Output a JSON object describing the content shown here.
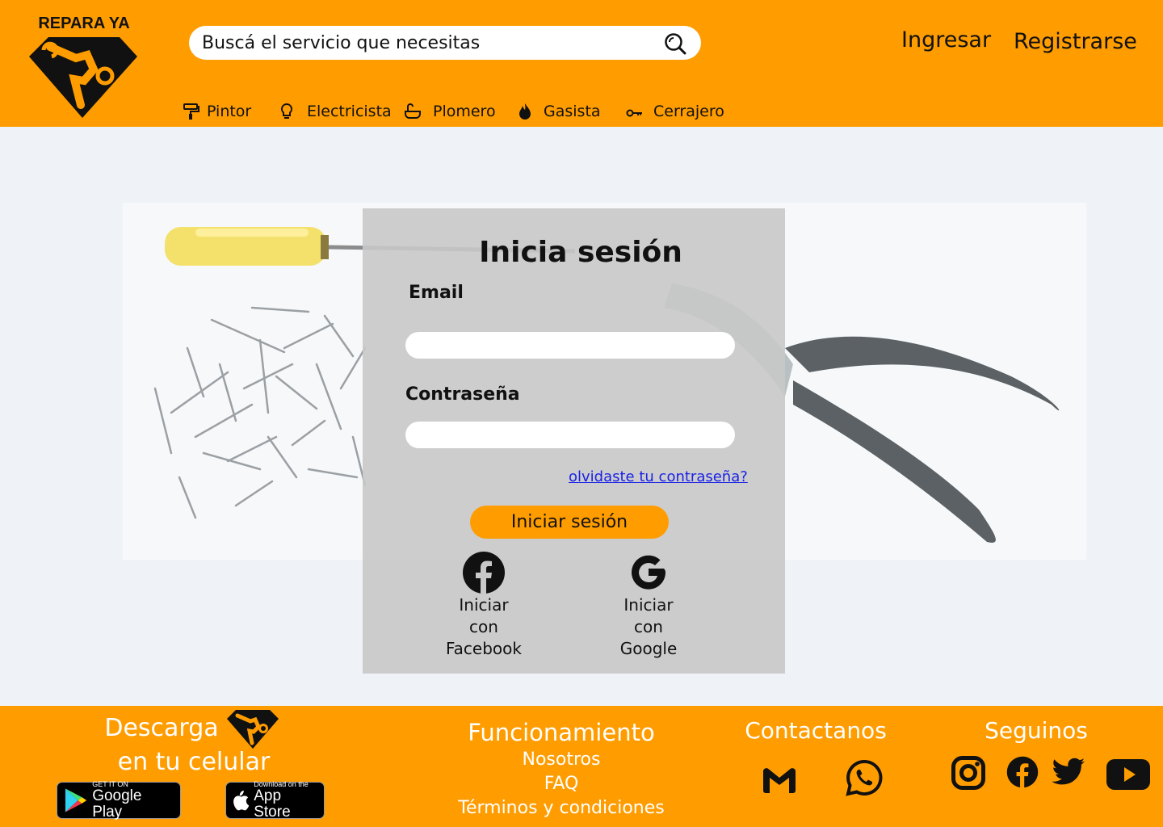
{
  "brand": {
    "name": "REPARA YA"
  },
  "search": {
    "placeholder": "Buscá el servicio que necesitas"
  },
  "auth": {
    "login_label": "Ingresar",
    "register_label": "Registrarse"
  },
  "nav": {
    "items": [
      {
        "label": "Pintor",
        "icon": "paint-roller-icon"
      },
      {
        "label": "Electricista",
        "icon": "lightbulb-icon"
      },
      {
        "label": "Plomero",
        "icon": "bathtub-icon"
      },
      {
        "label": "Gasista",
        "icon": "flame-icon"
      },
      {
        "label": "Cerrajero",
        "icon": "key-icon"
      }
    ]
  },
  "login": {
    "title": "Inicia sesión",
    "email_label": "Email",
    "password_label": "Contraseña",
    "forgot_label": "olvidaste tu contraseña?",
    "submit_label": "Iniciar sesión",
    "facebook": {
      "line1": "Iniciar",
      "line2": "con",
      "line3": "Facebook"
    },
    "google": {
      "line1": "Iniciar",
      "line2": "con",
      "line3": "Google"
    }
  },
  "footer": {
    "download_line1": "Descarga",
    "download_line2": "en tu celular",
    "google_play": {
      "small": "GET IT ON",
      "big": "Google Play"
    },
    "app_store": {
      "small": "Download on the",
      "big": "App Store"
    },
    "info_title": "Funcionamiento",
    "links": [
      "Nosotros",
      "FAQ",
      "Términos y condiciones"
    ],
    "contact_title": "Contactanos",
    "follow_title": "Seguinos"
  },
  "colors": {
    "primary": "#ff9c00",
    "background": "#eff3f7",
    "card": "#c8c8c8",
    "link": "#1a22e6"
  }
}
